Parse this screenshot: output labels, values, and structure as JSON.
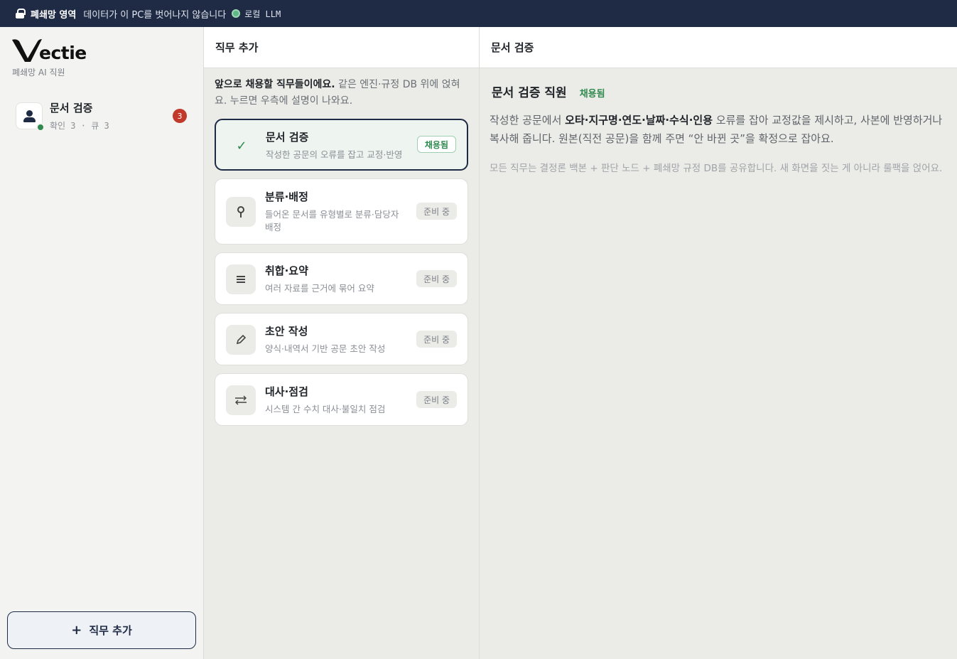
{
  "topbar": {
    "zone": "폐쇄망 영역",
    "message": "데이터가 이 PC를 벗어나지 않습니다",
    "llm": "로컬 LLM"
  },
  "sidebar": {
    "logo_text": "ectie",
    "logo_sub": "폐쇄망 AI 직원",
    "items": [
      {
        "title": "문서 검증",
        "meta": "확인 3 · 큐 3",
        "badge": "3"
      }
    ],
    "add_button": "직무 추가"
  },
  "middle": {
    "header": "직무 추가",
    "intro_bold": "앞으로 채용할 직무들이에요.",
    "intro_rest": " 같은 엔진·규정 DB 위에 얹혀요. 누르면 우측에 설명이 나와요.",
    "cards": [
      {
        "title": "문서 검증",
        "desc": "작성한 공문의 오류를 잡고 교정·반영",
        "status": "채용됨",
        "icon": "check-icon"
      },
      {
        "title": "분류·배정",
        "desc": "들어온 문서를 유형별로 분류·담당자 배정",
        "status": "준비 중",
        "icon": "pin-icon"
      },
      {
        "title": "취합·요약",
        "desc": "여러 자료를 근거에 묶어 요약",
        "status": "준비 중",
        "icon": "list-icon"
      },
      {
        "title": "초안 작성",
        "desc": "양식·내역서 기반 공문 초안 작성",
        "status": "준비 중",
        "icon": "pencil-icon"
      },
      {
        "title": "대사·점검",
        "desc": "시스템 간 수치 대사·불일치 점검",
        "status": "준비 중",
        "icon": "swap-icon"
      }
    ]
  },
  "right": {
    "header": "문서 검증",
    "title": "문서 검증 직원",
    "status": "채용됨",
    "desc_pre": "작성한 공문에서 ",
    "desc_bold": "오타·지구명·연도·날짜·수식·인용",
    "desc_post": " 오류를 잡아 교정값을 제시하고, 사본에 반영하거나 복사해 줍니다. 원본(직전 공문)을 함께 주면 “안 바뀐 곳”을 확정으로 잡아요.",
    "note": "모든 직무는 결정론 백본 + 판단 노드 + 폐쇄망 규정 DB를 공유합니다. 새 화면을 짓는 게 아니라 룰팩을 얹어요."
  },
  "colors": {
    "navy": "#1f2b45",
    "green": "#2f8a4f",
    "badge_red": "#c0392b"
  }
}
